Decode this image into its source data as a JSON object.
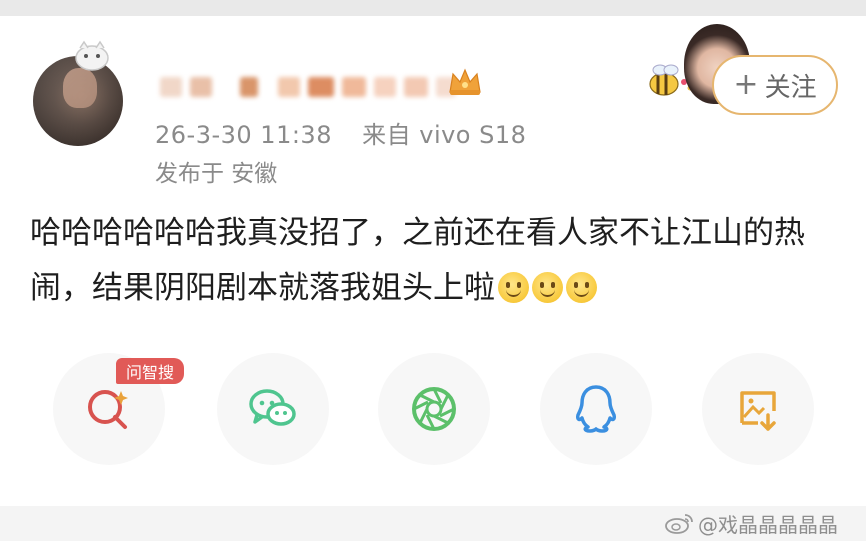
{
  "post": {
    "author": {
      "avatar_icon": "user-avatar-photo",
      "name_obscured": true,
      "badge_icon": "crown-vip-icon"
    },
    "timestamp": "26-3-30 11:38",
    "source": "来自 vivo S18",
    "location": "发布于 安徽",
    "body_text": "哈哈哈哈哈哈我真没招了，之前还在看人家不让江山的热闹，结果阴阳剧本就落我姐头上啦",
    "trailing_emojis": [
      "smile-emoji",
      "smile-emoji",
      "smile-emoji"
    ]
  },
  "follow_button": {
    "icon": "plus-icon",
    "label": "关注",
    "border_color": "#e6b66f"
  },
  "share_actions": [
    {
      "name": "ai-search",
      "icon": "ai-search-icon",
      "badge": "问智搜",
      "color": "#d8534f"
    },
    {
      "name": "wechat",
      "icon": "wechat-icon",
      "color": "#4fc58f"
    },
    {
      "name": "moments",
      "icon": "moments-icon",
      "color": "#5cc06a"
    },
    {
      "name": "qq",
      "icon": "qq-icon",
      "color": "#3b8fe0"
    },
    {
      "name": "save-image",
      "icon": "save-image-icon",
      "color": "#e8a63a"
    }
  ],
  "watermark": {
    "icon": "weibo-icon",
    "text": "@戏晶晶晶晶晶"
  }
}
